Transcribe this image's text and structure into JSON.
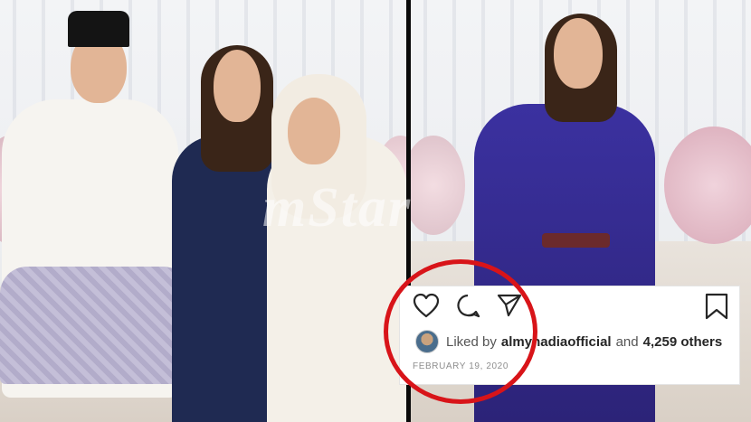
{
  "watermark": {
    "text": "mStar"
  },
  "instagram": {
    "icons": [
      "heart-icon",
      "comment-icon",
      "share-icon",
      "bookmark-icon"
    ],
    "liked_prefix": "Liked by",
    "liked_user": "almynadiaofficial",
    "liked_mid": "and",
    "liked_count": "4,259 others",
    "date": "FEBRUARY 19, 2020"
  },
  "colors": {
    "highlight_circle": "#d81419",
    "navy_dress": "#1f2a52",
    "blue_dress": "#3a2f9c",
    "white_outfit": "#f4f2ee",
    "sampin": "#b9b3cf"
  }
}
